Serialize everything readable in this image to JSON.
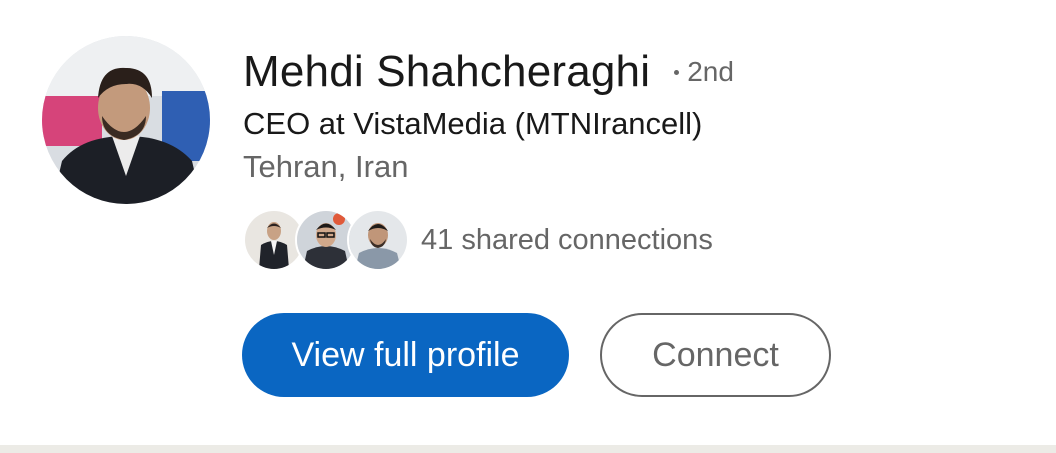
{
  "profile": {
    "name": "Mehdi Shahcheraghi",
    "degree": "2nd",
    "headline": "CEO at VistaMedia (MTNIrancell)",
    "location": "Tehran, Iran",
    "shared_connections_text": "41 shared connections",
    "shared_connection_avatars": [
      "connection-avatar-1",
      "connection-avatar-2",
      "connection-avatar-3"
    ]
  },
  "actions": {
    "primary_label": "View full profile",
    "secondary_label": "Connect"
  },
  "colors": {
    "primary": "#0a66c2",
    "text_primary": "#191919",
    "text_secondary": "#666666",
    "divider": "#ecebe6"
  }
}
